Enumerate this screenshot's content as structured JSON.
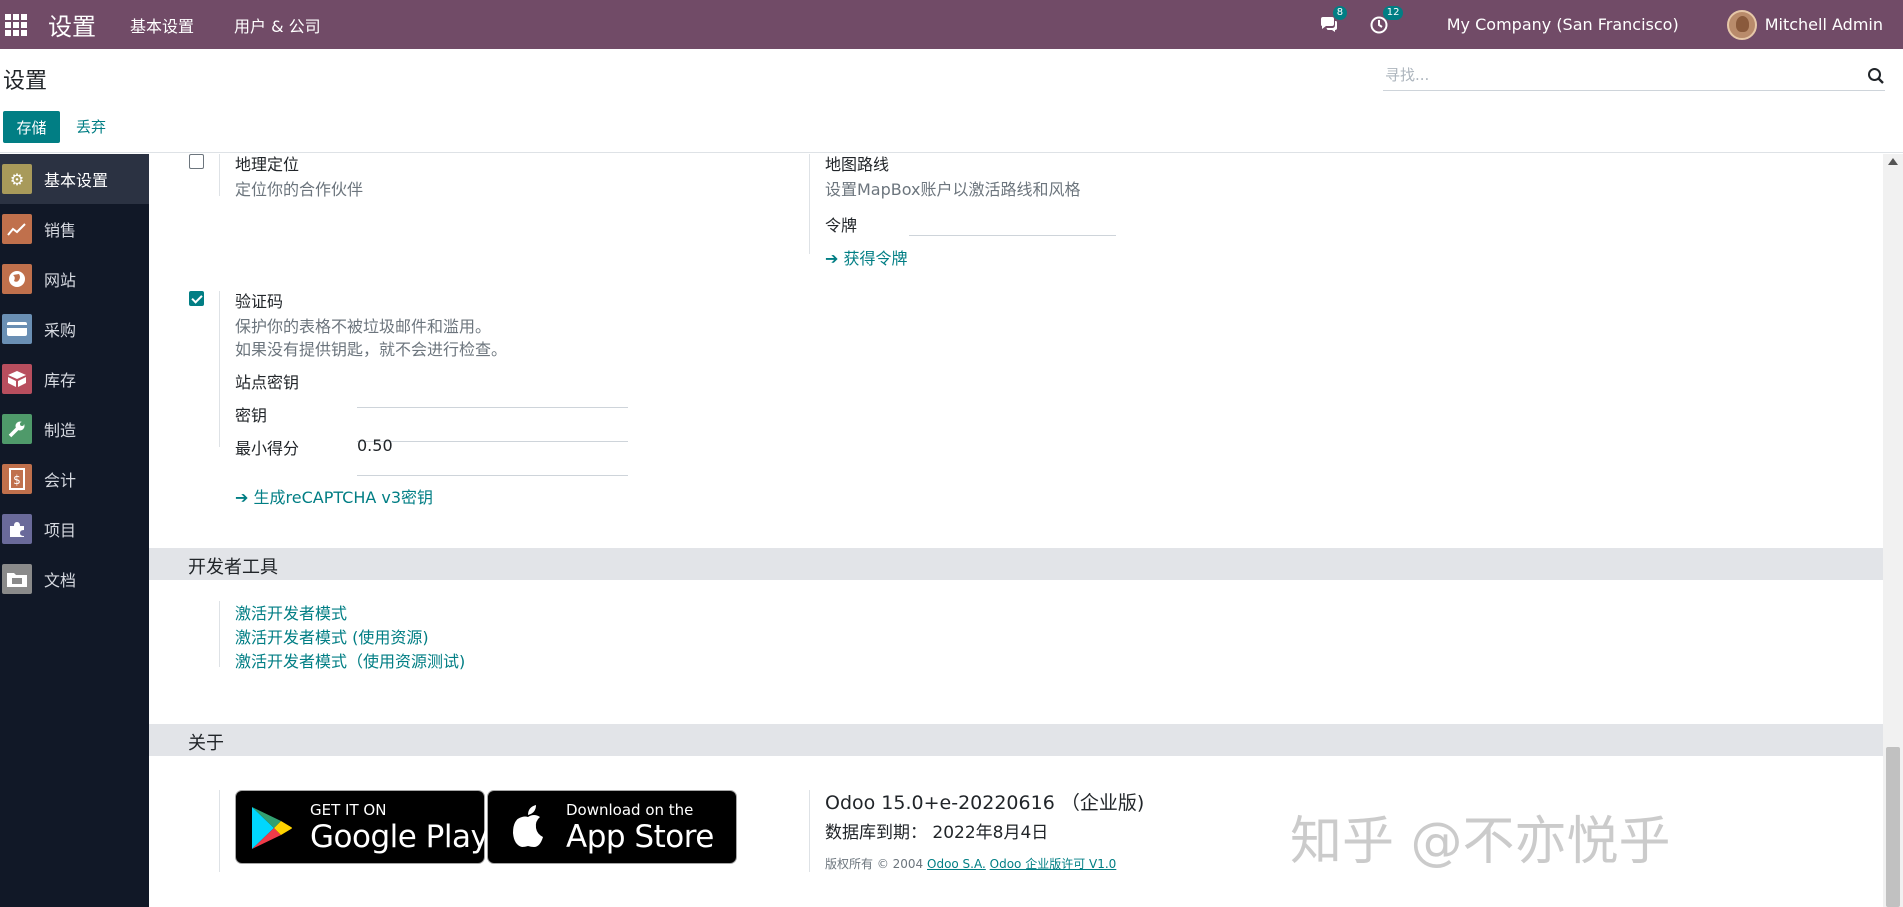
{
  "navbar": {
    "brand": "设置",
    "menus": [
      "基本设置",
      "用户 & 公司"
    ],
    "messages_count": "8",
    "activities_count": "12",
    "company": "My Company (San Francisco)",
    "user": "Mitchell Admin"
  },
  "control_panel": {
    "title": "设置",
    "search_placeholder": "寻找...",
    "save_label": "存储",
    "discard_label": "丢弃"
  },
  "sidebar": {
    "items": [
      {
        "label": "基本设置",
        "icon": "gear-icon",
        "color": "#a89a5a"
      },
      {
        "label": "销售",
        "icon": "chart-icon",
        "color": "#c0704c"
      },
      {
        "label": "网站",
        "icon": "globe-icon",
        "color": "#c0704c"
      },
      {
        "label": "采购",
        "icon": "card-icon",
        "color": "#6a8fb4"
      },
      {
        "label": "库存",
        "icon": "box-icon",
        "color": "#b84e5e"
      },
      {
        "label": "制造",
        "icon": "wrench-icon",
        "color": "#4f9a6a"
      },
      {
        "label": "会计",
        "icon": "invoice-icon",
        "color": "#c0704c"
      },
      {
        "label": "项目",
        "icon": "puzzle-icon",
        "color": "#6a6a9a"
      },
      {
        "label": "文档",
        "icon": "folder-icon",
        "color": "#8a8a8a"
      }
    ]
  },
  "settings": {
    "geo": {
      "title": "地理定位",
      "desc": "定位你的合作伙伴",
      "checked": false
    },
    "map": {
      "title": "地图路线",
      "desc": "设置MapBox账户以激活路线和风格",
      "token_label": "令牌",
      "token_value": "",
      "get_token": "获得令牌"
    },
    "captcha": {
      "title": "验证码",
      "desc1": "保护你的表格不被垃圾邮件和滥用。",
      "desc2": "如果没有提供钥匙，就不会进行检查。",
      "checked": true,
      "site_key_label": "站点密钥",
      "site_key_value": "",
      "secret_label": "密钥",
      "secret_value": "",
      "min_score_label": "最小得分",
      "min_score_value": "0.50",
      "generate_link": "生成reCAPTCHA v3密钥"
    }
  },
  "dev_tools": {
    "title": "开发者工具",
    "links": [
      "激活开发者模式",
      "激活开发者模式 (使用资源)",
      "激活开发者模式（使用资源测试)"
    ]
  },
  "about": {
    "title": "关于",
    "google_small": "GET IT ON",
    "google_big": "Google Play",
    "apple_small": "Download on the",
    "apple_big": "App Store",
    "version": "Odoo 15.0+e-20220616 （企业版)",
    "expiry_label": "数据库到期：",
    "expiry_date": "2022年8月4日",
    "copyright_prefix": "版权所有 © 2004",
    "copyright_link1": "Odoo S.A.",
    "copyright_link2": "Odoo 企业版许可 V1.0"
  },
  "watermark": "知乎 @不亦悦乎",
  "colors": {
    "navbar": "#714B67",
    "primary": "#017e84",
    "sidebar": "#111827"
  }
}
